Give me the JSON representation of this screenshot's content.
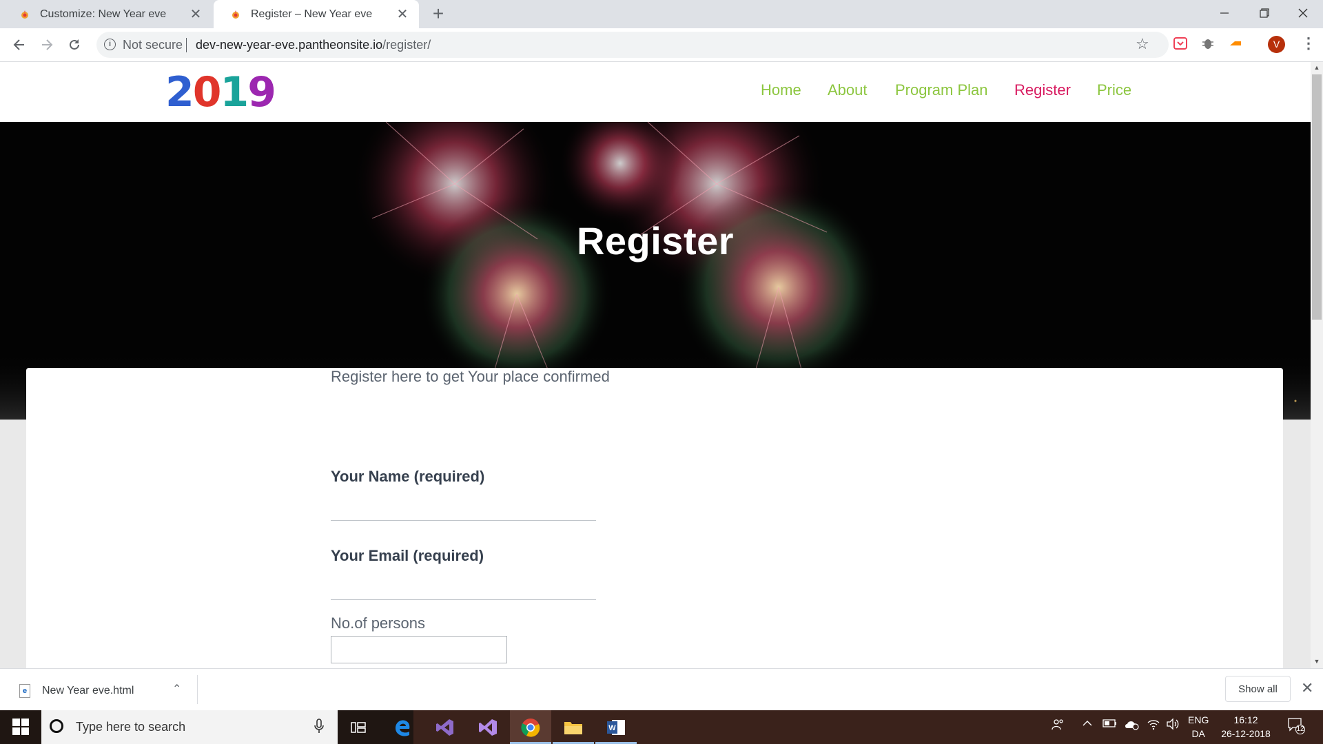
{
  "browser": {
    "tabs": [
      {
        "title": "Customize: New Year eve",
        "active": false
      },
      {
        "title": "Register – New Year eve",
        "active": true
      }
    ],
    "new_tab_icon": "plus-icon",
    "window_controls": [
      "minimize-icon",
      "maximize-icon",
      "close-icon"
    ],
    "security_label": "Not secure",
    "url_host": "dev-new-year-eve.pantheonsite.io",
    "url_path": "/register/",
    "profile_initial": "V"
  },
  "site": {
    "logo_text": "2019",
    "nav": [
      {
        "label": "Home",
        "active": false
      },
      {
        "label": "About",
        "active": false
      },
      {
        "label": "Program Plan",
        "active": false
      },
      {
        "label": "Register",
        "active": true
      },
      {
        "label": "Price",
        "active": false
      }
    ],
    "colors": {
      "nav": "#8cc63f",
      "nav_active": "#d81b60"
    }
  },
  "hero": {
    "title": "Register"
  },
  "form": {
    "intro": "Register here to get Your place confirmed",
    "name_label": "Your Name (required)",
    "email_label": "Your Email (required)",
    "persons_label": "No.of persons",
    "name_value": "",
    "email_value": "",
    "persons_value": ""
  },
  "download_shelf": {
    "file_name": "New Year eve.html",
    "show_all_label": "Show all"
  },
  "taskbar": {
    "search_placeholder": "Type here to search",
    "lang_line1": "ENG",
    "lang_line2": "DA",
    "time": "16:12",
    "date": "26-12-2018",
    "notification_count": "12"
  }
}
